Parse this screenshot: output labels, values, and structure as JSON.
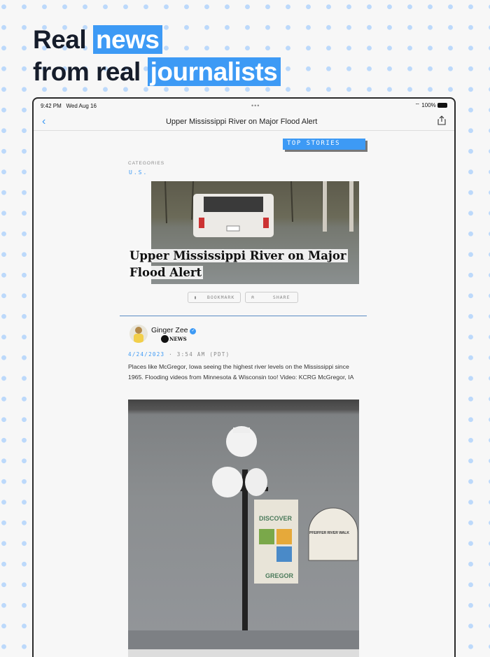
{
  "hero": {
    "line1_plain": "Real",
    "line1_highlight": "news",
    "line2_plain": "from real",
    "line2_highlight": "journalists"
  },
  "status": {
    "time": "9:42 PM",
    "date": "Wed Aug 16",
    "battery": "100%"
  },
  "nav": {
    "title": "Upper Mississippi River on Major Flood Alert"
  },
  "article": {
    "badge": "TOP STORIES",
    "categories_label": "CATEGORIES",
    "category": "U.S.",
    "title": "Upper Mississippi River on Major Flood Alert",
    "bookmark_label": "BOOKMARK",
    "share_label": "SHARE"
  },
  "post": {
    "author": "Ginger Zee",
    "outlet": "NEWS",
    "date": "4/24/2023",
    "time": " · 3:54 AM (PDT)",
    "text": "Places like McGregor, Iowa seeing the highest river levels on the Mississippi since 1965. Flooding videos from Minnesota & Wisconsin too! Video: KCRG McGregor, IA"
  },
  "video_sign": {
    "discover": "DISCOVER",
    "gregor": "GREGOR",
    "walk": "PFEIFFER RIVER WALK"
  },
  "colors": {
    "accent": "#3d9af5",
    "ink": "#161d2b"
  }
}
